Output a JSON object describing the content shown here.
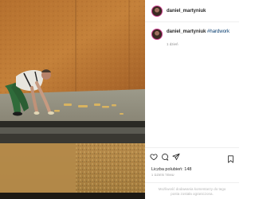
{
  "post": {
    "username": "daniel_martyniuk",
    "caption_username": "daniel_martyniuk",
    "hashtag": "#hardwork",
    "time_ago": "1 dzień",
    "likes_text": "Liczba polubień: 148",
    "date_text": "1 DZIEŃ TEMU",
    "comments_disabled_text": "Możliwość dodawania komentarzy do tego posta została ograniczona."
  },
  "icons": {
    "like": "heart-icon",
    "comment": "comment-icon",
    "share": "share-icon",
    "save": "bookmark-icon"
  },
  "colors": {
    "hashtag": "#00376b",
    "avatar_ring": "#c73a8a",
    "muted": "#8e8e8e"
  }
}
